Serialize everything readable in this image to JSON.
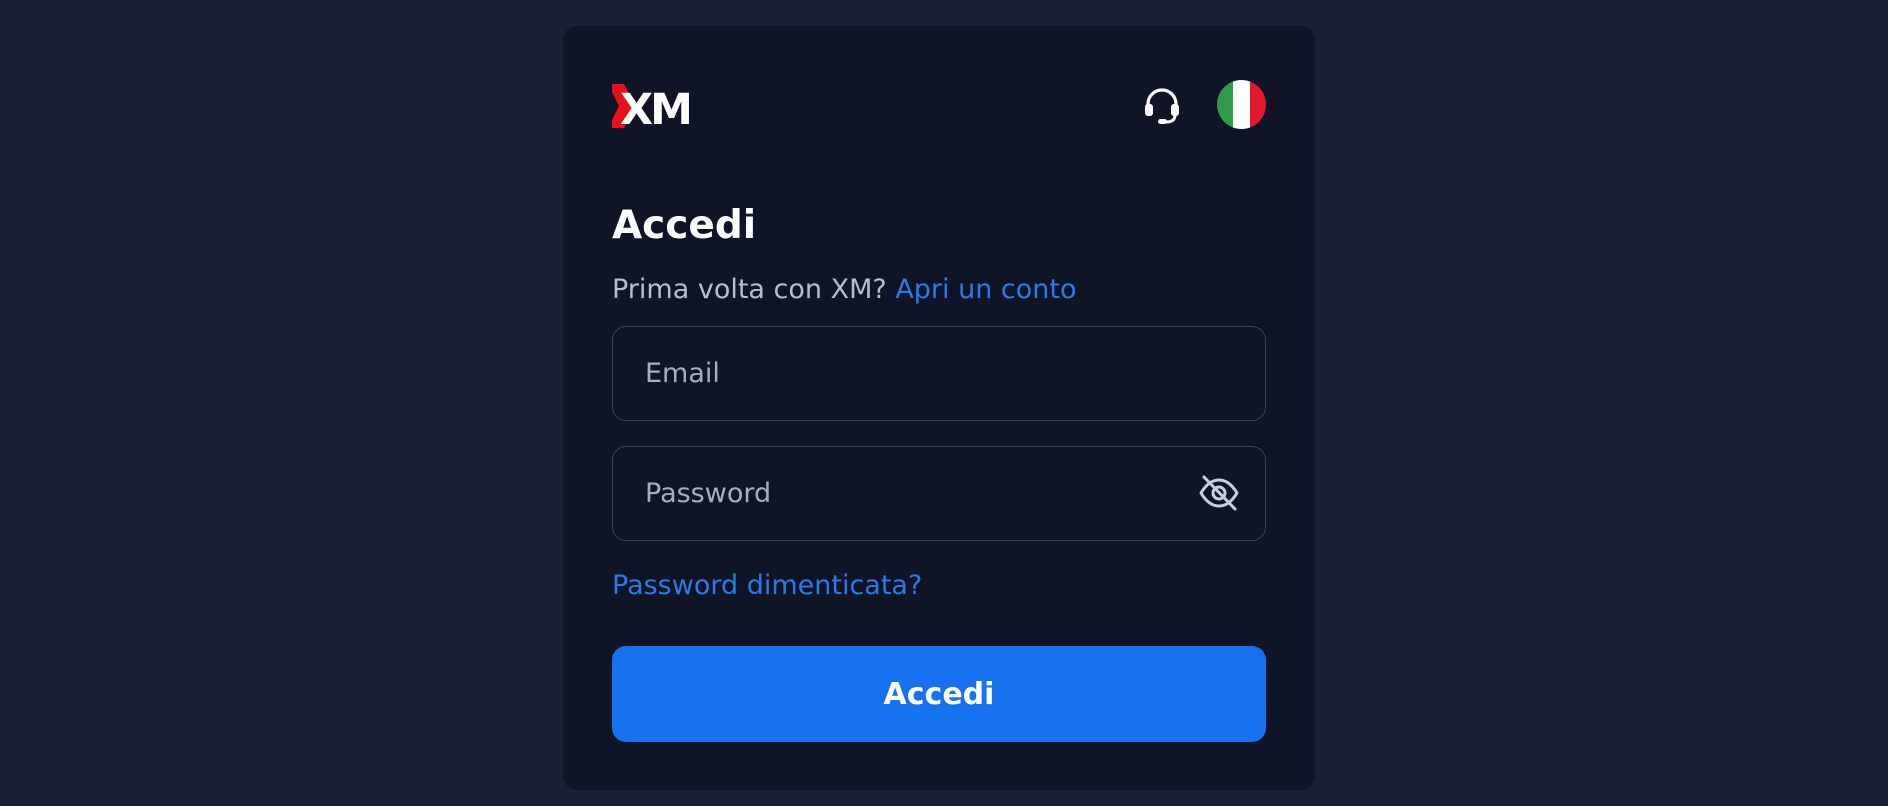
{
  "brand": {
    "logo_text": "XM",
    "accent": "#e8101e",
    "primary": "#1672ee",
    "link_color": "#2a7ae8"
  },
  "header": {
    "support_icon": "headset-icon",
    "language_flag": "italy-flag-icon",
    "flag_colors": [
      "#2f9a49",
      "#ffffff",
      "#e1192f"
    ]
  },
  "login": {
    "title": "Accedi",
    "prompt": "Prima volta con XM?",
    "open_account_link": "Apri un conto",
    "email_placeholder": "Email",
    "email_value": "",
    "password_placeholder": "Password",
    "password_value": "",
    "password_toggle_icon": "eye-off-icon",
    "forgot_password_link": "Password dimenticata?",
    "submit_label": "Accedi"
  }
}
